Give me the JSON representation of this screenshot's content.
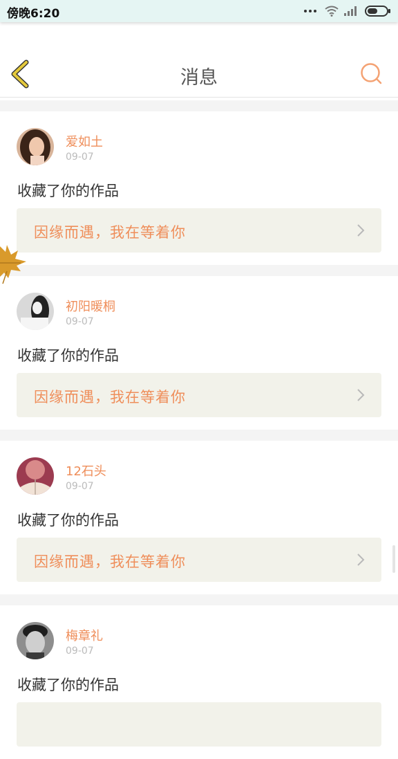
{
  "status": {
    "time": "傍晚6:20"
  },
  "header": {
    "title": "消息"
  },
  "messages": [
    {
      "user": "爱如土",
      "date": "09-07",
      "text": "收藏了你的作品",
      "work_title": "因缘而遇，我在等着你"
    },
    {
      "user": "初阳暖桐",
      "date": "09-07",
      "text": "收藏了你的作品",
      "work_title": "因缘而遇，我在等着你"
    },
    {
      "user": "12石头",
      "date": "09-07",
      "text": "收藏了你的作品",
      "work_title": "因缘而遇，我在等着你"
    },
    {
      "user": "梅章礼",
      "date": "09-07",
      "text": "收藏了你的作品",
      "work_title": ""
    }
  ],
  "colors": {
    "accent": "#ef8e5a",
    "back_icon": "#e4c93c",
    "work_bg": "#f2f2ea"
  },
  "icons": [
    "back-arrow-icon",
    "search-icon",
    "chevron-right-icon",
    "wifi-icon",
    "signal-icon",
    "battery-icon",
    "maple-leaf-icon"
  ]
}
